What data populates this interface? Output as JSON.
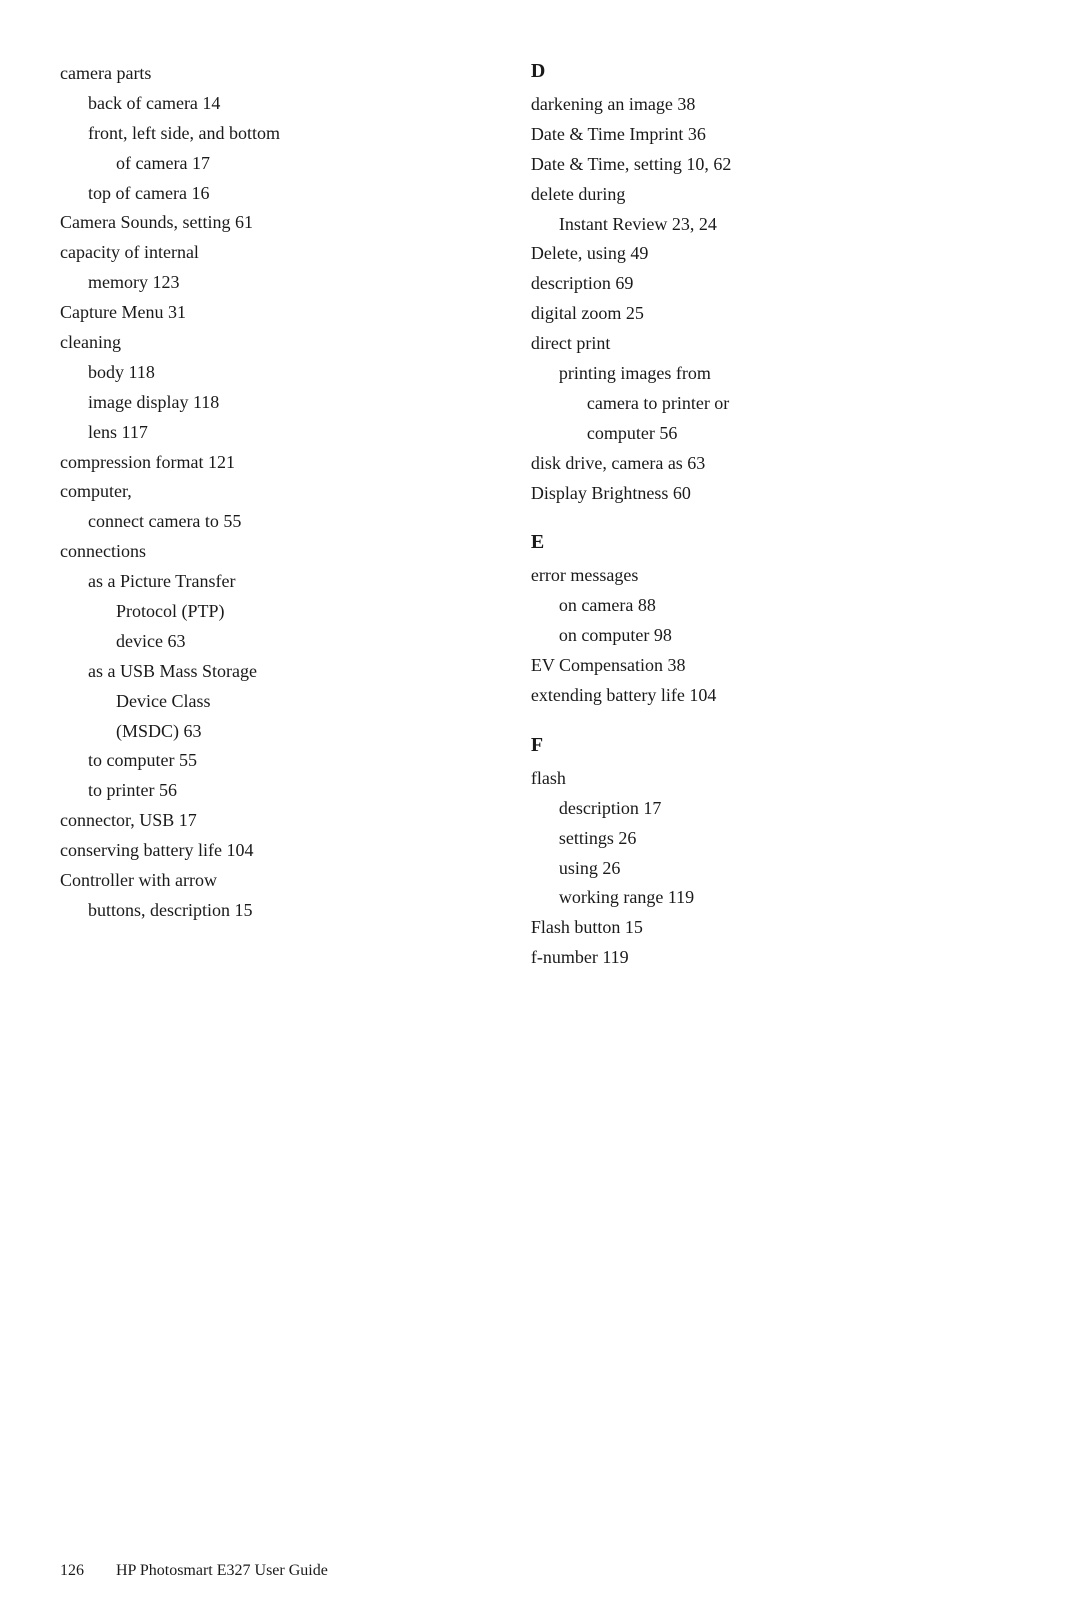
{
  "left_column": {
    "entries": [
      {
        "text": "camera parts",
        "page": "",
        "indent": 0
      },
      {
        "text": "back of camera",
        "page": "14",
        "indent": 1
      },
      {
        "text": "front, left side, and bottom",
        "page": "",
        "indent": 1
      },
      {
        "text": "of camera",
        "page": "17",
        "indent": 2
      },
      {
        "text": "top of camera",
        "page": "16",
        "indent": 1
      },
      {
        "text": "Camera Sounds, setting",
        "page": "61",
        "indent": 0
      },
      {
        "text": "capacity of internal",
        "page": "",
        "indent": 0
      },
      {
        "text": "memory",
        "page": "123",
        "indent": 1
      },
      {
        "text": "Capture Menu",
        "page": "31",
        "indent": 0
      },
      {
        "text": "cleaning",
        "page": "",
        "indent": 0
      },
      {
        "text": "body",
        "page": "118",
        "indent": 1
      },
      {
        "text": "image display",
        "page": "118",
        "indent": 1
      },
      {
        "text": "lens",
        "page": "117",
        "indent": 1
      },
      {
        "text": "compression format",
        "page": "121",
        "indent": 0
      },
      {
        "text": "computer,",
        "page": "",
        "indent": 0
      },
      {
        "text": "connect camera to",
        "page": "55",
        "indent": 1
      },
      {
        "text": "connections",
        "page": "",
        "indent": 0
      },
      {
        "text": "as a Picture Transfer",
        "page": "",
        "indent": 1
      },
      {
        "text": "Protocol (PTP)",
        "page": "",
        "indent": 2
      },
      {
        "text": "device",
        "page": "63",
        "indent": 2
      },
      {
        "text": "as a USB Mass Storage",
        "page": "",
        "indent": 1
      },
      {
        "text": "Device Class",
        "page": "",
        "indent": 2
      },
      {
        "text": "(MSDC)",
        "page": "63",
        "indent": 2
      },
      {
        "text": "to computer",
        "page": "55",
        "indent": 1
      },
      {
        "text": "to printer",
        "page": "56",
        "indent": 1
      },
      {
        "text": "connector, USB",
        "page": "17",
        "indent": 0
      },
      {
        "text": "conserving battery life",
        "page": "104",
        "indent": 0
      },
      {
        "text": "Controller with arrow",
        "page": "",
        "indent": 0
      },
      {
        "text": "buttons, description",
        "page": "15",
        "indent": 1
      }
    ]
  },
  "right_column": {
    "sections": [
      {
        "letter": "D",
        "entries": [
          {
            "text": "darkening an image",
            "page": "38",
            "indent": 0
          },
          {
            "text": "Date & Time Imprint",
            "page": "36",
            "indent": 0
          },
          {
            "text": "Date & Time, setting",
            "page": "10,  62",
            "indent": 0
          },
          {
            "text": "delete during",
            "page": "",
            "indent": 0
          },
          {
            "text": "Instant Review",
            "page": "23,  24",
            "indent": 1
          },
          {
            "text": "Delete, using",
            "page": "49",
            "indent": 0
          },
          {
            "text": "description",
            "page": "69",
            "indent": 0
          },
          {
            "text": "digital zoom",
            "page": "25",
            "indent": 0
          },
          {
            "text": "direct print",
            "page": "",
            "indent": 0
          },
          {
            "text": "printing images from",
            "page": "",
            "indent": 1
          },
          {
            "text": "camera to printer or",
            "page": "",
            "indent": 2
          },
          {
            "text": "computer",
            "page": "56",
            "indent": 2
          },
          {
            "text": "disk drive, camera as",
            "page": "63",
            "indent": 0
          },
          {
            "text": "Display Brightness",
            "page": "60",
            "indent": 0
          }
        ]
      },
      {
        "letter": "E",
        "entries": [
          {
            "text": "error messages",
            "page": "",
            "indent": 0
          },
          {
            "text": "on camera",
            "page": "88",
            "indent": 1
          },
          {
            "text": "on computer",
            "page": "98",
            "indent": 1
          },
          {
            "text": "EV Compensation",
            "page": "38",
            "indent": 0
          },
          {
            "text": "extending battery life",
            "page": "104",
            "indent": 0
          }
        ]
      },
      {
        "letter": "F",
        "entries": [
          {
            "text": "flash",
            "page": "",
            "indent": 0
          },
          {
            "text": "description",
            "page": "17",
            "indent": 1
          },
          {
            "text": "settings",
            "page": "26",
            "indent": 1
          },
          {
            "text": "using",
            "page": "26",
            "indent": 1
          },
          {
            "text": "working range",
            "page": "119",
            "indent": 1
          },
          {
            "text": "Flash button",
            "page": "15",
            "indent": 0
          },
          {
            "text": "f-number",
            "page": "119",
            "indent": 0
          }
        ]
      }
    ]
  },
  "footer": {
    "page_number": "126",
    "title": "HP Photosmart E327 User Guide"
  }
}
